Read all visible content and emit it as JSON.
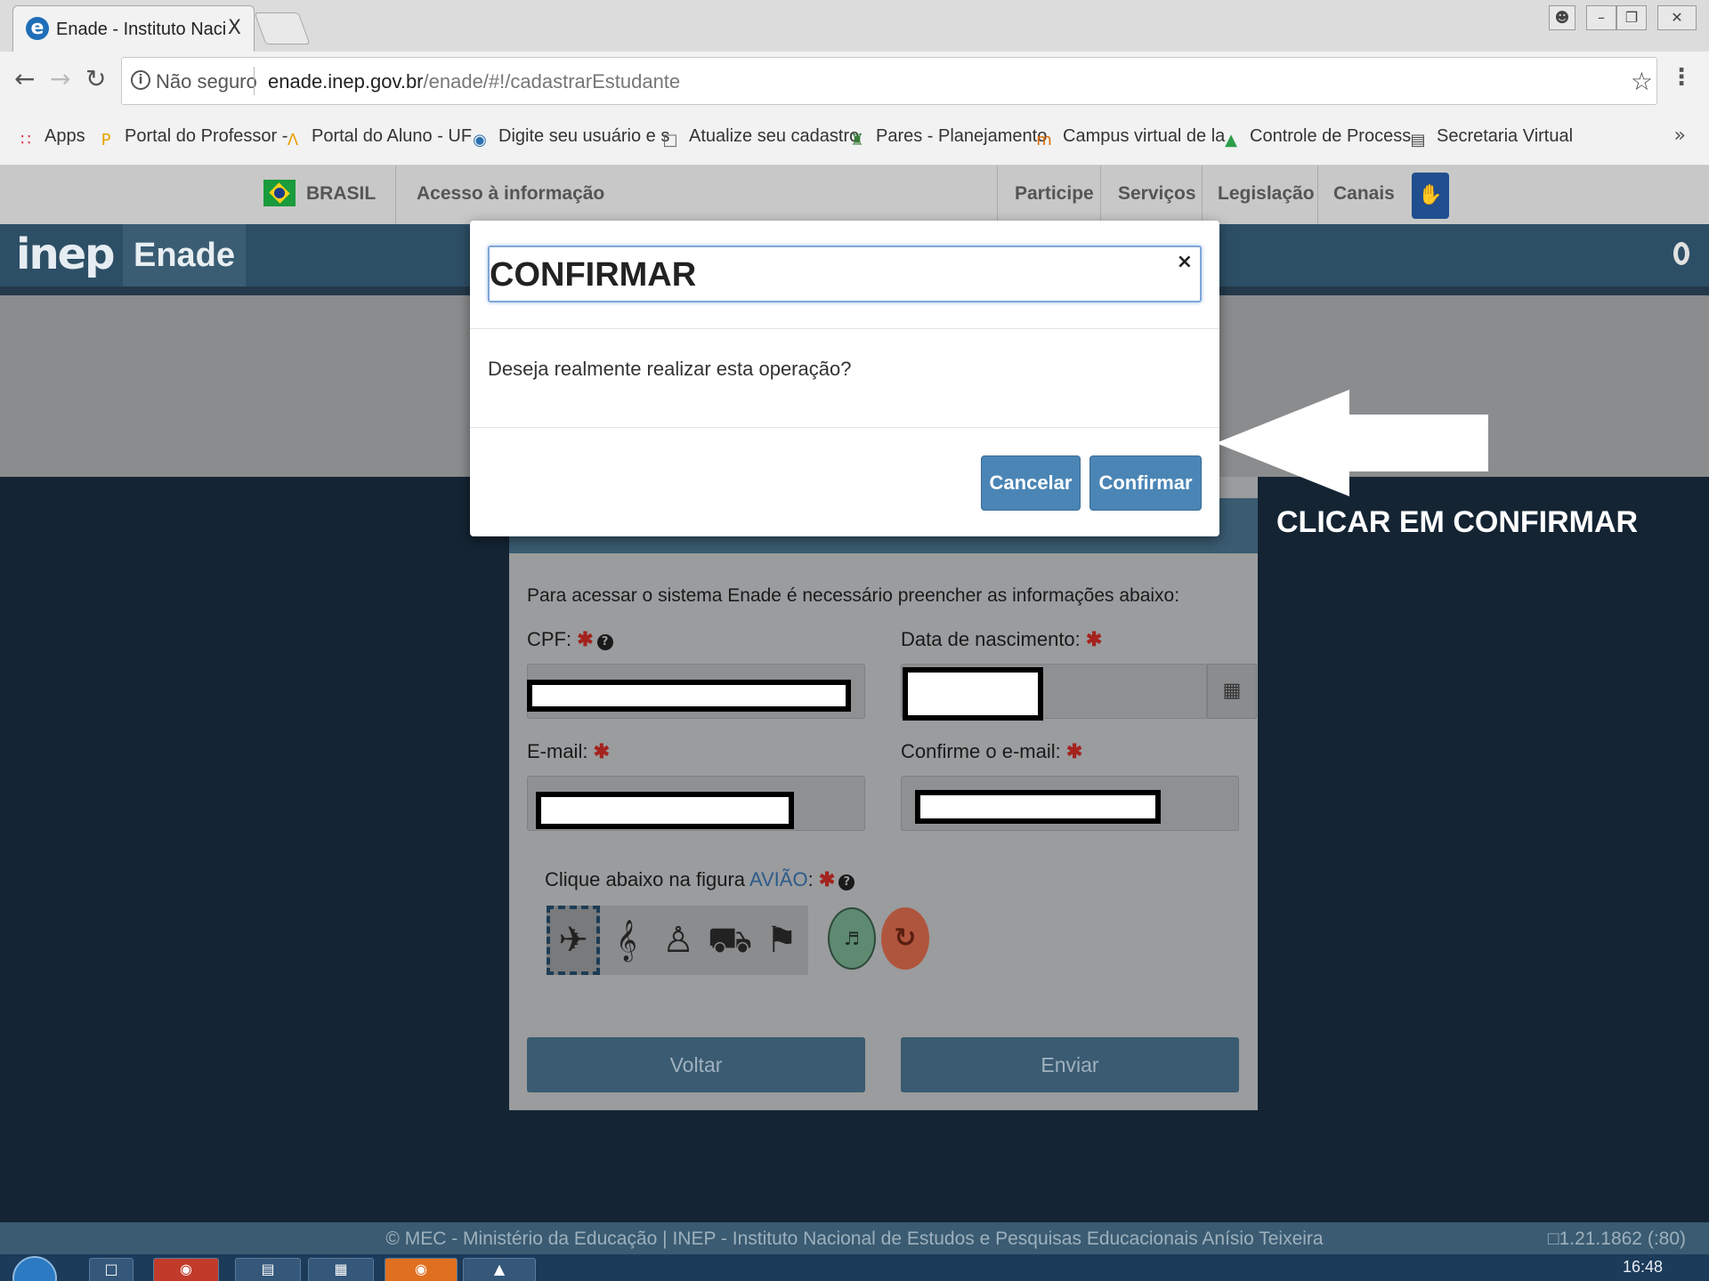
{
  "browser": {
    "tab_title": "Enade - Instituto Naciona",
    "tab_close": "X",
    "security_label": "Não seguro",
    "url_domain": "enade.inep.gov.br",
    "url_path": "/enade/#!/cadastrarEstudante",
    "bookmarks": [
      {
        "label": "Apps",
        "icon": "apps-grid-icon"
      },
      {
        "label": "Portal do Professor -",
        "icon": "portal-professor-icon"
      },
      {
        "label": "Portal do Aluno - UF",
        "icon": "portal-aluno-icon"
      },
      {
        "label": "Digite seu usuário e s",
        "icon": "globe-icon"
      },
      {
        "label": "Atualize seu cadastro",
        "icon": "document-icon"
      },
      {
        "label": "Pares - Planejamento",
        "icon": "pares-icon"
      },
      {
        "label": "Campus virtual de la",
        "icon": "campus-icon"
      },
      {
        "label": "Controle de Process",
        "icon": "drive-icon"
      },
      {
        "label": "Secretaria Virtual",
        "icon": "secretaria-icon"
      }
    ],
    "more_bookmarks": "»"
  },
  "gov": {
    "brasil": "BRASIL",
    "acesso": "Acesso à informação",
    "links": [
      "Participe",
      "Serviços",
      "Legislação",
      "Canais"
    ]
  },
  "inep": {
    "logo": "inep",
    "app": "Enade"
  },
  "form": {
    "intro": "Para acessar o sistema Enade é necessário preencher as informações abaixo:",
    "cpf_label": "CPF:",
    "birth_label": "Data de nascimento:",
    "email_label": "E-mail:",
    "confirm_email_label": "Confirme o e-mail:",
    "required_mark": "✱",
    "captcha_prefix": "Clique abaixo na figura",
    "captcha_target": "AVIÃO",
    "captcha_suffix": ":",
    "captcha_icons": [
      "airplane-icon",
      "treble-clef-icon",
      "robot-icon",
      "tshirt-icon",
      "flag-icon"
    ],
    "back_button": "Voltar",
    "send_button": "Enviar"
  },
  "modal": {
    "title": "CONFIRMAR",
    "close": "×",
    "message": "Deseja realmente realizar esta operação?",
    "cancel": "Cancelar",
    "confirm": "Confirmar"
  },
  "annotation": {
    "text": "CLICAR EM CONFIRMAR"
  },
  "footer": {
    "text": "© MEC - Ministério da Educação | INEP - Instituto Nacional de Estudos e Pesquisas Educacionais Anísio Teixeira",
    "version": "1.21.1862 (:80)"
  },
  "taskbar": {
    "time": "16:48"
  },
  "colors": {
    "inep_blue": "#2d4f66",
    "modal_button": "#4a85b5",
    "required": "#a4231f"
  }
}
